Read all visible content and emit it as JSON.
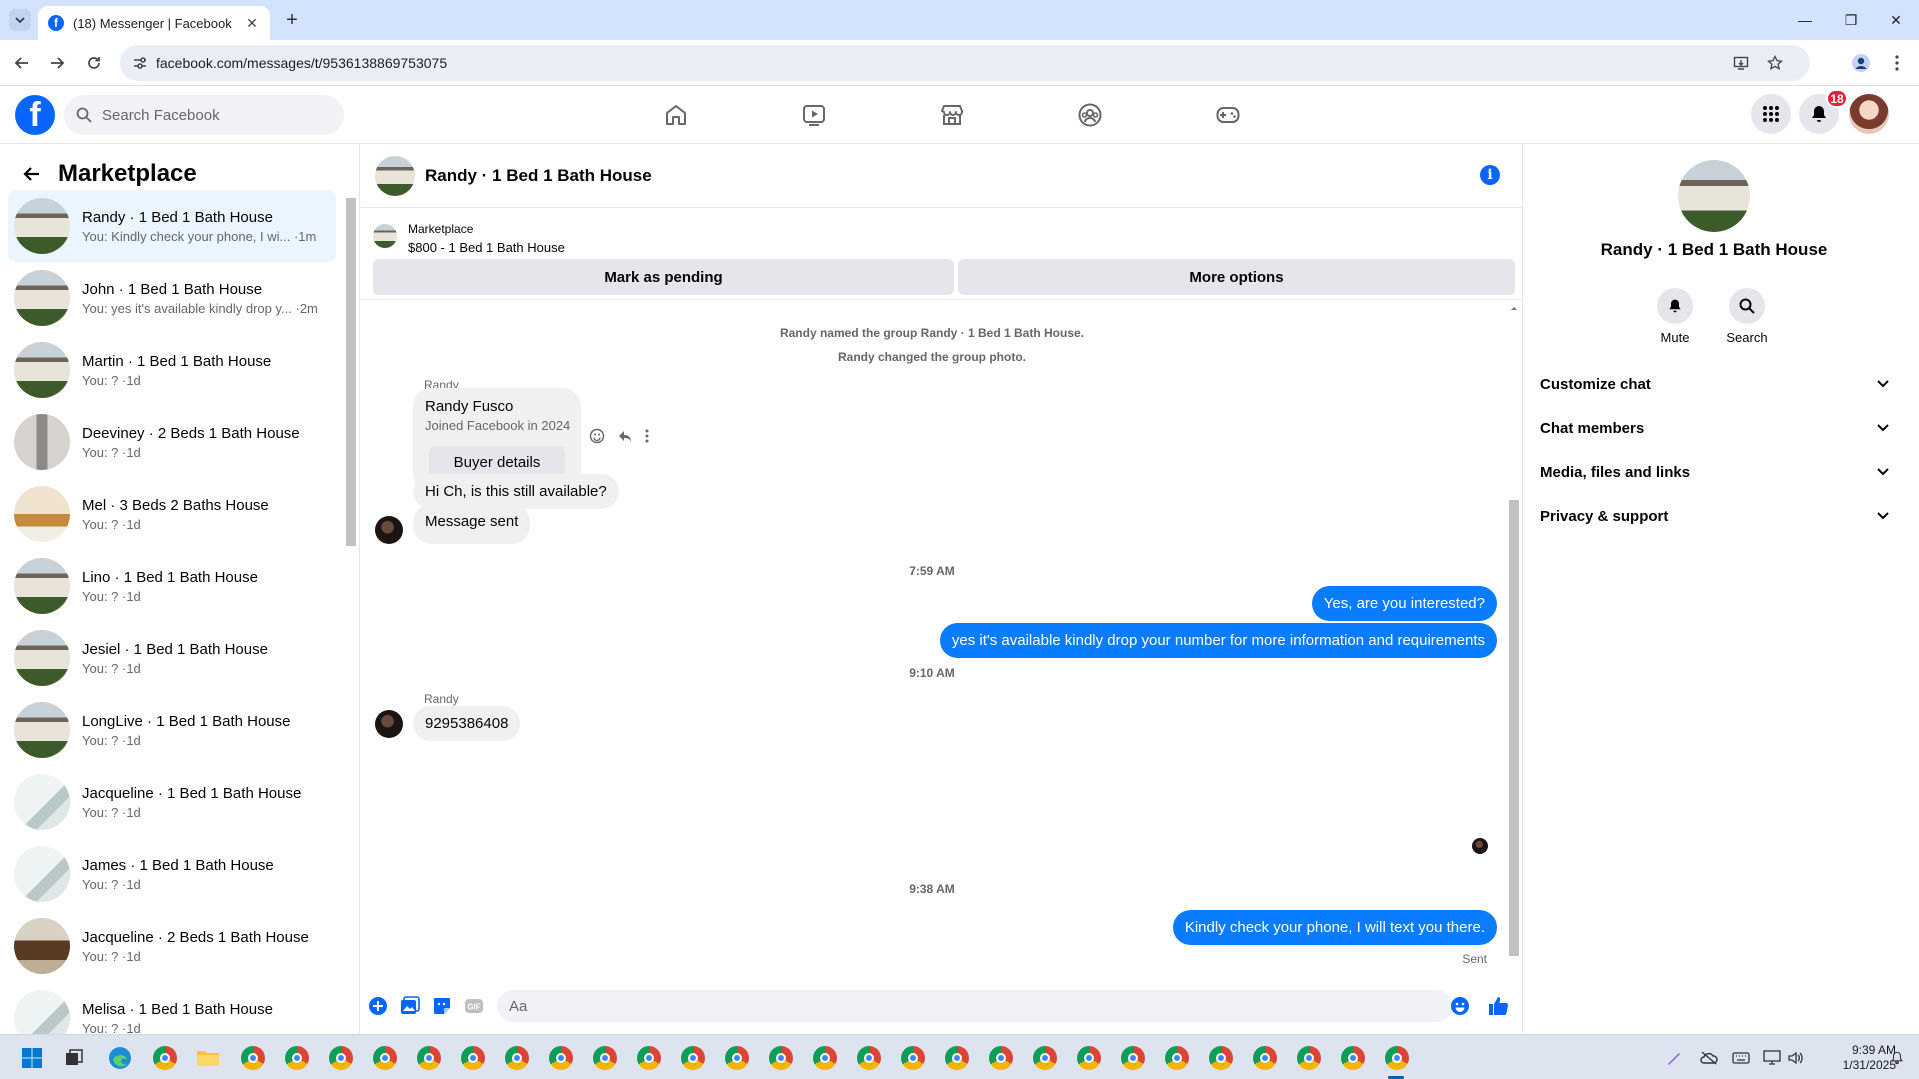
{
  "browser": {
    "tab_title": "(18) Messenger | Facebook",
    "url": "facebook.com/messages/t/9536138869753075"
  },
  "header": {
    "search_placeholder": "Search Facebook",
    "notification_count": "18",
    "nav_icons": [
      "home-icon",
      "video-icon",
      "marketplace-icon",
      "groups-icon",
      "gaming-icon"
    ]
  },
  "sidebar": {
    "title": "Marketplace",
    "conversations": [
      {
        "name": "Randy · 1 Bed 1 Bath House",
        "preview": "You: Kindly check your phone, I wi... ·1m",
        "thumb": "house"
      },
      {
        "name": "John · 1 Bed 1 Bath House",
        "preview": "You: yes it's available kindly drop y... ·2m",
        "thumb": "house"
      },
      {
        "name": "Martin · 1 Bed 1 Bath House",
        "preview": "You: ? ·1d",
        "thumb": "house"
      },
      {
        "name": "Deeviney · 2 Beds 1 Bath House",
        "preview": "You: ? ·1d",
        "thumb": "house2"
      },
      {
        "name": "Mel · 3 Beds 2 Baths House",
        "preview": "You: ? ·1d",
        "thumb": "house3"
      },
      {
        "name": "Lino · 1 Bed 1 Bath House",
        "preview": "You: ? ·1d",
        "thumb": "house"
      },
      {
        "name": "Jesiel · 1 Bed 1 Bath House",
        "preview": "You: ? ·1d",
        "thumb": "house"
      },
      {
        "name": "LongLive · 1 Bed 1 Bath House",
        "preview": "You: ? ·1d",
        "thumb": "house"
      },
      {
        "name": "Jacqueline · 1 Bed 1 Bath House",
        "preview": "You: ? ·1d",
        "thumb": "house4"
      },
      {
        "name": "James · 1 Bed 1 Bath House",
        "preview": "You: ? ·1d",
        "thumb": "house4"
      },
      {
        "name": "Jacqueline · 2 Beds 1 Bath House",
        "preview": "You: ? ·1d",
        "thumb": "house5"
      },
      {
        "name": "Melisa · 1 Bed 1 Bath House",
        "preview": "You: ? ·1d",
        "thumb": "house4"
      }
    ]
  },
  "chat": {
    "title": "Randy · 1 Bed 1 Bath House",
    "marketplace_label": "Marketplace",
    "listing": "$800 - 1 Bed 1 Bath House",
    "mark_pending": "Mark as pending",
    "more_options": "More options",
    "system_1": "Randy named the group Randy · 1 Bed 1 Bath House.",
    "system_2": "Randy changed the group photo.",
    "sender_name": "Randy",
    "buyer_name": "Randy Fusco",
    "buyer_joined": "Joined Facebook in 2024",
    "buyer_details": "Buyer details",
    "msg_in_1": "Hi Ch, is this still available?",
    "msg_in_2": "Message sent",
    "time_1": "7:59 AM",
    "msg_out_1": "Yes, are you interested?",
    "msg_out_2": "yes it's available kindly drop your number for more information and requirements",
    "time_2": "9:10 AM",
    "sender_name_2": "Randy",
    "msg_in_3": "9295386408",
    "time_3": "9:38 AM",
    "msg_out_3": "Kindly check your phone, I will text you there.",
    "status": "Sent",
    "composer_placeholder": "Aa"
  },
  "details": {
    "name": "Randy · 1 Bed 1 Bath House",
    "mute": "Mute",
    "search": "Search",
    "sections": [
      "Customize chat",
      "Chat members",
      "Media, files and links",
      "Privacy & support"
    ]
  },
  "taskbar": {
    "time": "9:39 AM",
    "date": "1/31/2025"
  },
  "colors": {
    "accent": "#0866ff",
    "outgoing_bubble": "#0a7cff",
    "incoming_bubble": "#f0f0f0",
    "badge": "#e41e3f"
  }
}
